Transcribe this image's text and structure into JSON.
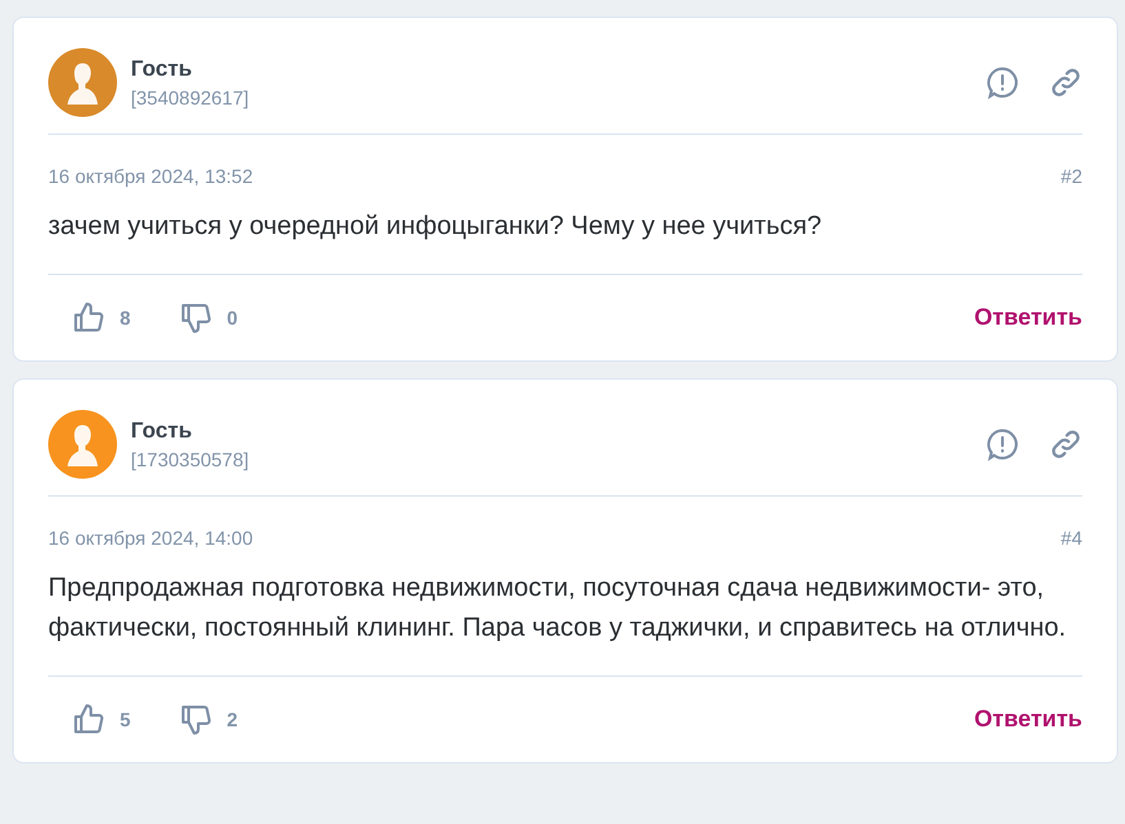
{
  "comments": [
    {
      "author": "Гость",
      "user_id": "[3540892617]",
      "color": "#d98a2a",
      "date": "16 октября 2024, 13:52",
      "number": "#2",
      "text": "зачем учиться у очередной инфоцыганки? Чему у нее учиться?",
      "likes": "8",
      "dislikes": "0",
      "reply": "Ответить"
    },
    {
      "author": "Гость",
      "user_id": "[1730350578]",
      "color": "#f7931e",
      "date": "16 октября 2024, 14:00",
      "number": "#4",
      "text": "Предпродажная подготовка недвижимости, посуточная сдача недвижимости- это, фактически, постоянный клининг. Пара часов у таджички, и справитесь на отлично.",
      "likes": "5",
      "dislikes": "2",
      "reply": "Ответить"
    }
  ]
}
